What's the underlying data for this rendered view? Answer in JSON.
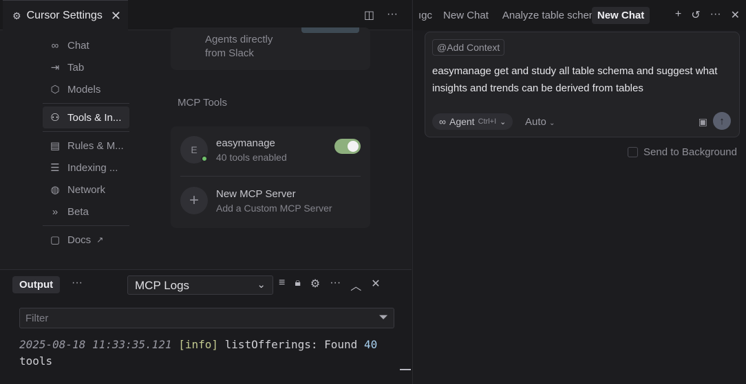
{
  "editor": {
    "tab_title": "Cursor Settings"
  },
  "settings_nav": {
    "items": [
      {
        "label": "Chat",
        "icon": "infinity-icon"
      },
      {
        "label": "Tab",
        "icon": "arrow-right-tab-icon"
      },
      {
        "label": "Models",
        "icon": "cube-icon"
      },
      {
        "label": "Tools & In...",
        "icon": "tools-icon",
        "active": true
      },
      {
        "label": "Rules & M...",
        "icon": "clipboard-icon"
      },
      {
        "label": "Indexing ...",
        "icon": "database-icon"
      },
      {
        "label": "Network",
        "icon": "globe-icon"
      },
      {
        "label": "Beta",
        "icon": "chevrons-right-icon"
      },
      {
        "label": "Docs",
        "icon": "book-icon"
      }
    ]
  },
  "settings": {
    "top_card_line1": "Agents directly",
    "top_card_line2": "from Slack",
    "mcp_section_title": "MCP Tools",
    "servers": [
      {
        "name": "easymanage",
        "initial": "E",
        "subtitle": "40 tools enabled",
        "enabled": true,
        "status_color": "#6fbf6a"
      }
    ],
    "new_server_title": "New MCP Server",
    "new_server_subtitle": "Add a Custom MCP Server"
  },
  "panel": {
    "tab_label": "Output",
    "more": "···",
    "log_source": "MCP Logs",
    "filter_placeholder": "Filter",
    "log": {
      "timestamp": "2025-08-18 11:33:35.121",
      "level": "[info]",
      "message": "listOfferings: Found",
      "count": "40",
      "tail": "tools"
    }
  },
  "chat": {
    "tabs": [
      "ıgc",
      "New Chat",
      "Analyze table schem",
      "New Chat"
    ],
    "active_tab_index": 3,
    "add_context": "Add Context",
    "prompt": "easymanage get and study all table schema and suggest what insights and trends can be derived from tables",
    "mode_label": "Agent",
    "mode_shortcut": "Ctrl+I",
    "model_label": "Auto",
    "send_to_background": "Send to Background"
  }
}
